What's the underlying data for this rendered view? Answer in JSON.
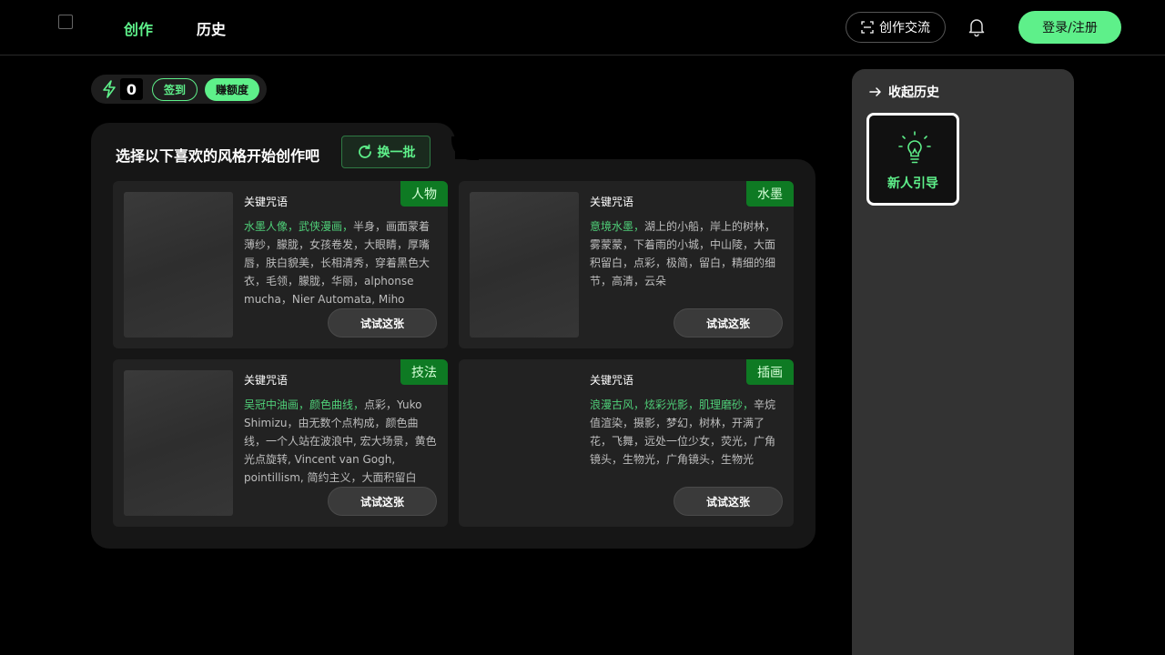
{
  "header": {
    "nav": [
      {
        "label": "创作",
        "active": true
      },
      {
        "label": "历史",
        "active": false
      }
    ],
    "exchange_label": "创作交流",
    "login_label": "登录/注册",
    "icons": {
      "exchange": "scan-icon",
      "notifications": "bell-icon",
      "logo": "broken-image-icon"
    }
  },
  "credits": {
    "icon": "lightning-icon",
    "value": "0",
    "sign_in_label": "签到",
    "earn_label": "赚额度"
  },
  "styles_panel": {
    "title": "选择以下喜欢的风格开始创作吧",
    "refresh_label": "换一批",
    "cards": [
      {
        "tag": "人物",
        "prompt_label": "关键咒语",
        "highlight": "水墨人像，武侠漫画，",
        "prompt": "半身，画面蒙着薄纱，朦胧，女孩卷发，大眼睛，厚嘴唇，肤白貌美，长相清秀，穿着黑色大衣，毛领，朦胧，华丽，alphonse mucha，Nier Automata, Miho",
        "try_label": "试试这张",
        "has_image": true
      },
      {
        "tag": "水墨",
        "prompt_label": "关键咒语",
        "highlight": "意境水墨，",
        "prompt": "湖上的小船，岸上的树林，雾蒙蒙，下着雨的小城，中山陵，大面积留白，点彩，极简，留白，精细的细节，高清，云朵",
        "try_label": "试试这张",
        "has_image": true
      },
      {
        "tag": "技法",
        "prompt_label": "关键咒语",
        "highlight": "吴冠中油画，颜色曲线，",
        "prompt": "点彩，Yuko Shimizu，由无数个点构成，颜色曲线，一个人站在波浪中, 宏大场景，黄色光点旋转, Vincent van Gogh, pointillism, 简约主义，大面积留白",
        "try_label": "试试这张",
        "has_image": true
      },
      {
        "tag": "插画",
        "prompt_label": "关键咒语",
        "highlight": "浪漫古风，炫彩光影，肌理磨砂，",
        "prompt": "辛烷值渲染，摄影，梦幻，树林，开满了花，飞舞，远处一位少女，荧光，广角镜头，生物光，广角镜头，生物光",
        "try_label": "试试这张",
        "has_image": false
      }
    ]
  },
  "sidebar": {
    "collapse_label": "收起历史",
    "guide_label": "新人引导",
    "icons": {
      "collapse": "arrow-right-icon",
      "guide": "lightbulb-icon"
    }
  },
  "colors": {
    "accent": "#5ef08a",
    "tag_bg": "#0e7a23",
    "panel_bg": "#161616",
    "card_bg": "#222222",
    "sidebar_bg": "#333333"
  }
}
